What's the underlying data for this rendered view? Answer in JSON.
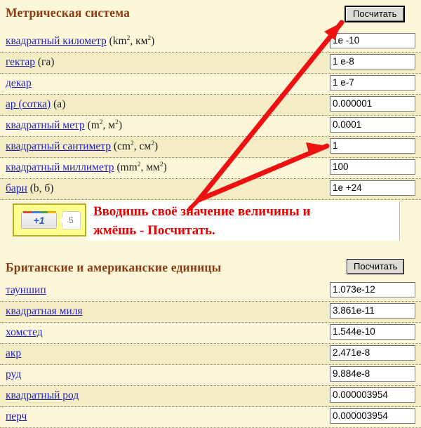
{
  "sections": [
    {
      "id": "metric",
      "title": "Метрическая система",
      "calc_label": "Посчитать",
      "rows": [
        {
          "name": "квадратный километр",
          "suffix": "(km2, км2)",
          "unit_a": "km",
          "unit_b": "км",
          "value": "1e -10"
        },
        {
          "name": "гектар",
          "suffix": "(га)",
          "unit_a": "",
          "unit_b": "",
          "value": "1 e-8"
        },
        {
          "name": "декар",
          "suffix": "",
          "unit_a": "",
          "unit_b": "",
          "value": "1 e-7"
        },
        {
          "name": "ар (сотка)",
          "suffix": "(а)",
          "unit_a": "",
          "unit_b": "",
          "value": "0.000001"
        },
        {
          "name": "квадратный метр",
          "suffix": "(m2, м2)",
          "unit_a": "m",
          "unit_b": "м",
          "value": "0.0001"
        },
        {
          "name": "квадратный сантиметр",
          "suffix": "(cm2, см2)",
          "unit_a": "cm",
          "unit_b": "см",
          "value": "1"
        },
        {
          "name": "квадратный миллиметр",
          "suffix": "(mm2, мм2)",
          "unit_a": "mm",
          "unit_b": "мм",
          "value": "100"
        },
        {
          "name": "барн",
          "suffix": "(b, б)",
          "unit_a": "",
          "unit_b": "",
          "value": "1e +24"
        }
      ]
    },
    {
      "id": "imperial",
      "title": "Британские и американские единицы",
      "calc_label": "Посчитать",
      "rows": [
        {
          "name": "тауншип",
          "suffix": "",
          "unit_a": "",
          "unit_b": "",
          "value": "1.073e-12"
        },
        {
          "name": "квадратная миля",
          "suffix": "",
          "unit_a": "",
          "unit_b": "",
          "value": "3.861e-11"
        },
        {
          "name": "хомстед",
          "suffix": "",
          "unit_a": "",
          "unit_b": "",
          "value": "1.544e-10"
        },
        {
          "name": "акр",
          "suffix": "",
          "unit_a": "",
          "unit_b": "",
          "value": "2.471e-8"
        },
        {
          "name": "руд",
          "suffix": "",
          "unit_a": "",
          "unit_b": "",
          "value": "9.884e-8"
        },
        {
          "name": "квадратный род",
          "suffix": "",
          "unit_a": "",
          "unit_b": "",
          "value": "0.000003954"
        },
        {
          "name": "перч",
          "suffix": "",
          "unit_a": "",
          "unit_b": "",
          "value": "0.000003954"
        }
      ]
    }
  ],
  "promo": {
    "plus_one_label": "+1",
    "plus_one_count": "5",
    "annotation_line1": "Вводишь своё значение величины и",
    "annotation_line2": "жмёшь - Посчитать."
  },
  "colors": {
    "page_background": "#fdf6d8",
    "row_alt_background": "#f3ecc4",
    "heading": "#8a3b14",
    "link": "#2222bb",
    "annotation": "#ee0000",
    "arrow": "#ee1111",
    "plus_one_border": "#b6aa2c",
    "plus_one_background": "#ffff8e"
  }
}
